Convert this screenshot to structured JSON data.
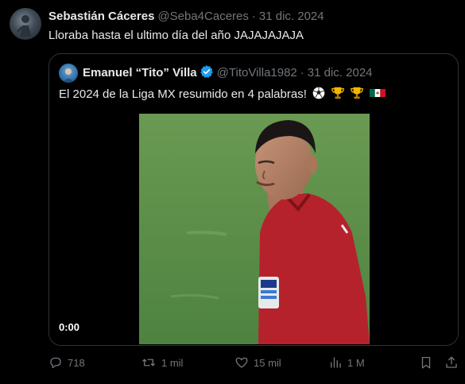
{
  "tweet": {
    "author": {
      "name": "Sebastián Cáceres",
      "handle": "@Seba4Caceres",
      "date": "31 dic. 2024"
    },
    "text": "Lloraba hasta el ultimo día del año JAJAJAJAJA",
    "quote": {
      "author": {
        "name": "Emanuel “Tito” Villa",
        "handle": "@TitoVilla1982",
        "date": "31 dic. 2024",
        "verified": true
      },
      "text": "El 2024 de la Liga MX resumido en 4 palabras!",
      "emojis": [
        "soccer-ball",
        "trophy",
        "trophy",
        "mexico-flag"
      ],
      "video": {
        "timecode": "0:00"
      }
    },
    "actions": {
      "replies": "718",
      "reposts": "1 mil",
      "likes": "15 mil",
      "views": "1 M"
    }
  },
  "colors": {
    "background": "#000000",
    "text": "#e7e9ea",
    "muted": "#71767b",
    "border": "#2f3336",
    "verified": "#1d9bf0",
    "field": "#5d8d47",
    "jersey": "#b5222c"
  },
  "separator": "·"
}
